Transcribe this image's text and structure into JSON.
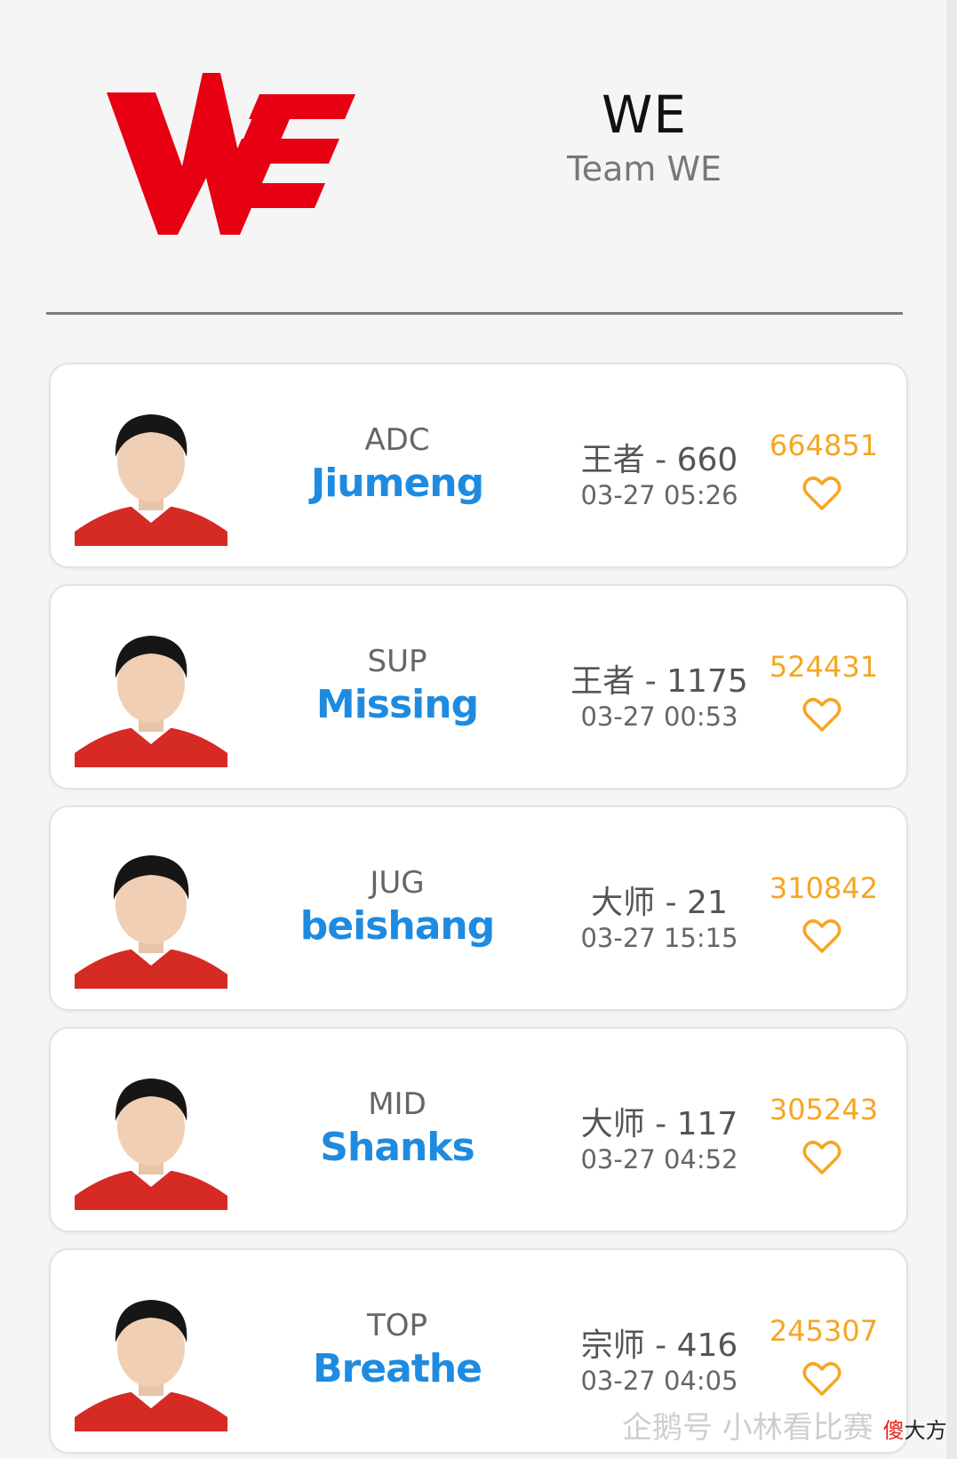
{
  "team": {
    "short_name": "WE",
    "full_name": "Team WE",
    "logo_icon": "we-logo",
    "brand_color": "#e60012"
  },
  "accent_colors": {
    "name": "#1e8be0",
    "score": "#f5a623"
  },
  "players": [
    {
      "role": "ADC",
      "name": "Jiumeng",
      "rank": "王者 - 660",
      "time": "03-27 05:26",
      "score": "664851",
      "icon": "heart-outline-icon"
    },
    {
      "role": "SUP",
      "name": "Missing",
      "rank": "王者 - 1175",
      "time": "03-27 00:53",
      "score": "524431",
      "icon": "heart-outline-icon"
    },
    {
      "role": "JUG",
      "name": "beishang",
      "rank": "大师 - 21",
      "time": "03-27 15:15",
      "score": "310842",
      "icon": "heart-outline-icon"
    },
    {
      "role": "MID",
      "name": "Shanks",
      "rank": "大师 - 117",
      "time": "03-27 04:52",
      "score": "305243",
      "icon": "heart-outline-icon"
    },
    {
      "role": "TOP",
      "name": "Breathe",
      "rank": "宗师 - 416",
      "time": "03-27 04:05",
      "score": "245307",
      "icon": "heart-outline-icon"
    }
  ],
  "watermark": {
    "text": "企鹅号 小林看比赛",
    "stamp_red": "傻",
    "stamp_black": "大方"
  }
}
